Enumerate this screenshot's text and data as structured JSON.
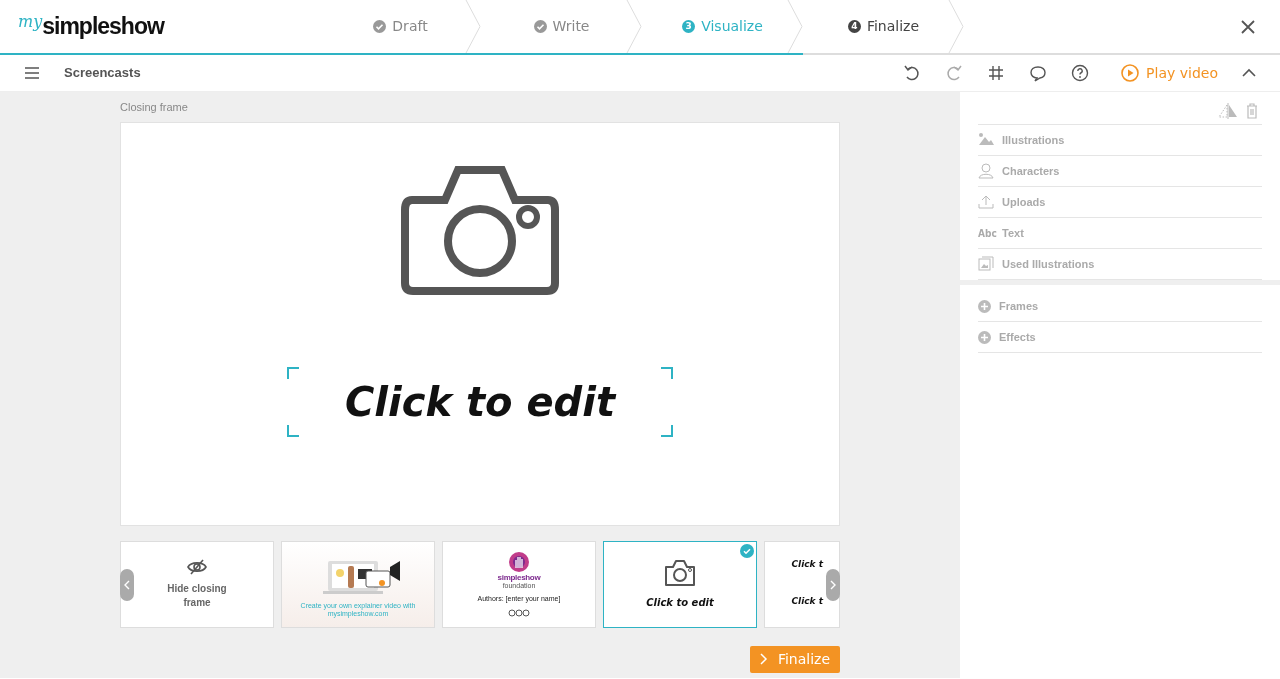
{
  "logo": {
    "prefix": "my",
    "name": "simpleshow"
  },
  "steps": [
    {
      "label": "Draft",
      "completed": true,
      "selected": false
    },
    {
      "label": "Write",
      "completed": true,
      "selected": false
    },
    {
      "label": "Visualize",
      "number": "3",
      "completed": false,
      "selected": true
    },
    {
      "label": "Finalize",
      "number": "4",
      "completed": false,
      "selected": false
    }
  ],
  "toolbar": {
    "title": "Screencasts",
    "play_label": "Play video"
  },
  "canvas": {
    "label": "Closing frame",
    "text": "Click to edit"
  },
  "thumbnails": [
    {
      "kind": "hide",
      "text": "Hide closing frame",
      "selected": false
    },
    {
      "kind": "illustration",
      "text": "Create your own explainer video with mysimpleshow.com",
      "selected": false
    },
    {
      "kind": "foundation",
      "title": "simpleshow",
      "subtitle": "foundation",
      "text": "Authors: [enter your name]",
      "selected": false
    },
    {
      "kind": "camera",
      "text": "Click to edit",
      "selected": true
    },
    {
      "kind": "text",
      "lines": [
        "Click t",
        "Click t"
      ],
      "selected": false
    }
  ],
  "finalize_button": "Finalize",
  "panel": {
    "items": [
      {
        "kind": "illustrations",
        "label": "Illustrations"
      },
      {
        "kind": "characters",
        "label": "Characters"
      },
      {
        "kind": "uploads",
        "label": "Uploads"
      },
      {
        "kind": "text",
        "icon_text": "Abc",
        "label": "Text"
      },
      {
        "kind": "used",
        "label": "Used Illustrations"
      }
    ],
    "sections": [
      {
        "label": "Frames"
      },
      {
        "label": "Effects"
      }
    ]
  }
}
